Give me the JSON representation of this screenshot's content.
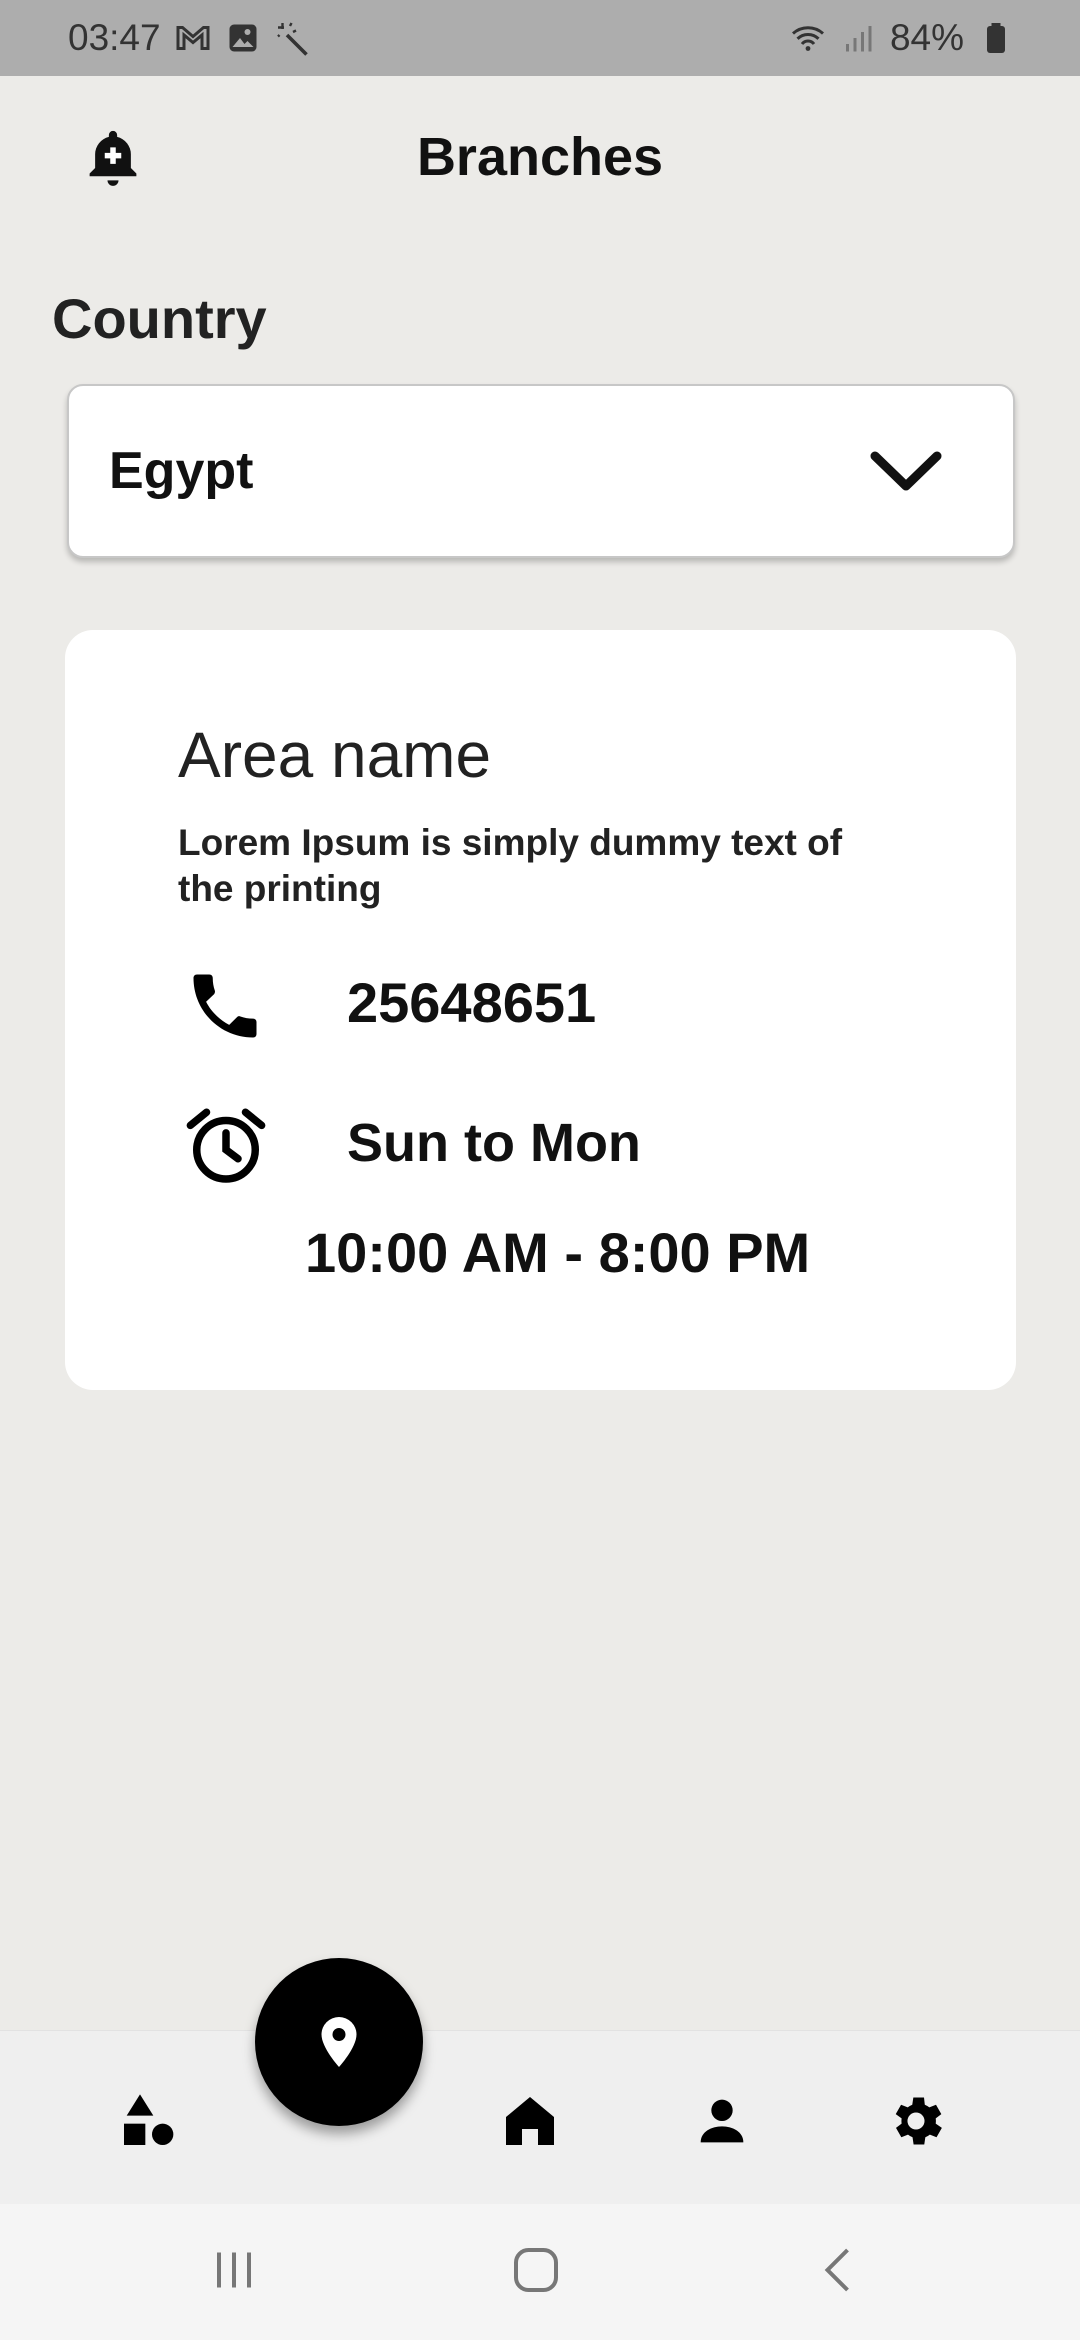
{
  "status_bar": {
    "time": "03:47",
    "battery": "84%",
    "icons": [
      "gmail-icon",
      "gallery-icon",
      "magic-wand-icon",
      "wifi-icon",
      "signal-icon",
      "battery-icon"
    ]
  },
  "header": {
    "title": "Branches",
    "left_icon": "bell-plus-icon"
  },
  "country": {
    "label": "Country",
    "selected": "Egypt",
    "dropdown_icon": "chevron-down-icon"
  },
  "branch": {
    "area_name": "Area name",
    "description": "Lorem Ipsum is simply dummy text of the printing",
    "phone": "25648651",
    "days": "Sun to Mon",
    "hours": "10:00 AM - 8:00 PM"
  },
  "bottom_nav": {
    "items": [
      {
        "icon": "categories-icon",
        "active": false
      },
      {
        "icon": "location-pin-icon",
        "active": true
      },
      {
        "icon": "home-icon",
        "active": false
      },
      {
        "icon": "profile-icon",
        "active": false
      },
      {
        "icon": "settings-gear-icon",
        "active": false
      }
    ],
    "active_color": "#000000"
  },
  "system_nav": {
    "items": [
      "recent-apps-icon",
      "home-circle-icon",
      "back-icon"
    ]
  },
  "colors": {
    "background": "#ecebe8",
    "card": "#ffffff",
    "status_bar": "#adadad",
    "text": "#222222"
  }
}
